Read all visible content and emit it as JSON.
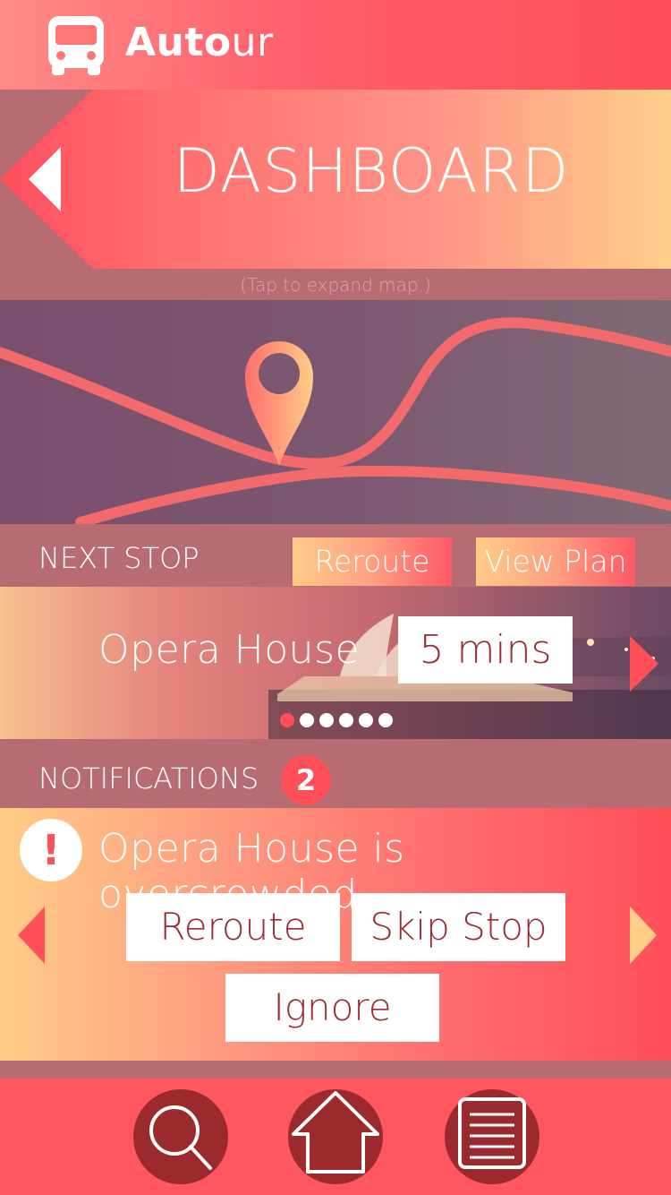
{
  "app": {
    "title_bold": "Auto",
    "title_light": "ur",
    "logo_icon": "bus-icon"
  },
  "dashboard": {
    "title": "DASHBOARD",
    "map_hint": "(Tap to expand map.)"
  },
  "next_stop": {
    "label": "NEXT STOP",
    "reroute_label": "Reroute",
    "view_plan_label": "View Plan",
    "stop_name": "Opera House",
    "eta": "5 mins",
    "dots_total": 6,
    "dots_active_index": 0
  },
  "notifications": {
    "label": "NOTIFICATIONS",
    "count": "2",
    "alert_symbol": "!",
    "message": "Opera House is overcrowded",
    "actions": {
      "reroute": "Reroute",
      "skip": "Skip Stop",
      "ignore": "Ignore"
    }
  },
  "bottom_nav": {
    "items": [
      {
        "name": "search",
        "icon": "search-icon"
      },
      {
        "name": "home",
        "icon": "home-icon"
      },
      {
        "name": "list",
        "icon": "list-icon"
      }
    ]
  },
  "colors": {
    "accent": "#ff4f58",
    "dark_accent": "#9b2a2e",
    "background": "#b76c74",
    "button_text": "#9c2a32"
  }
}
